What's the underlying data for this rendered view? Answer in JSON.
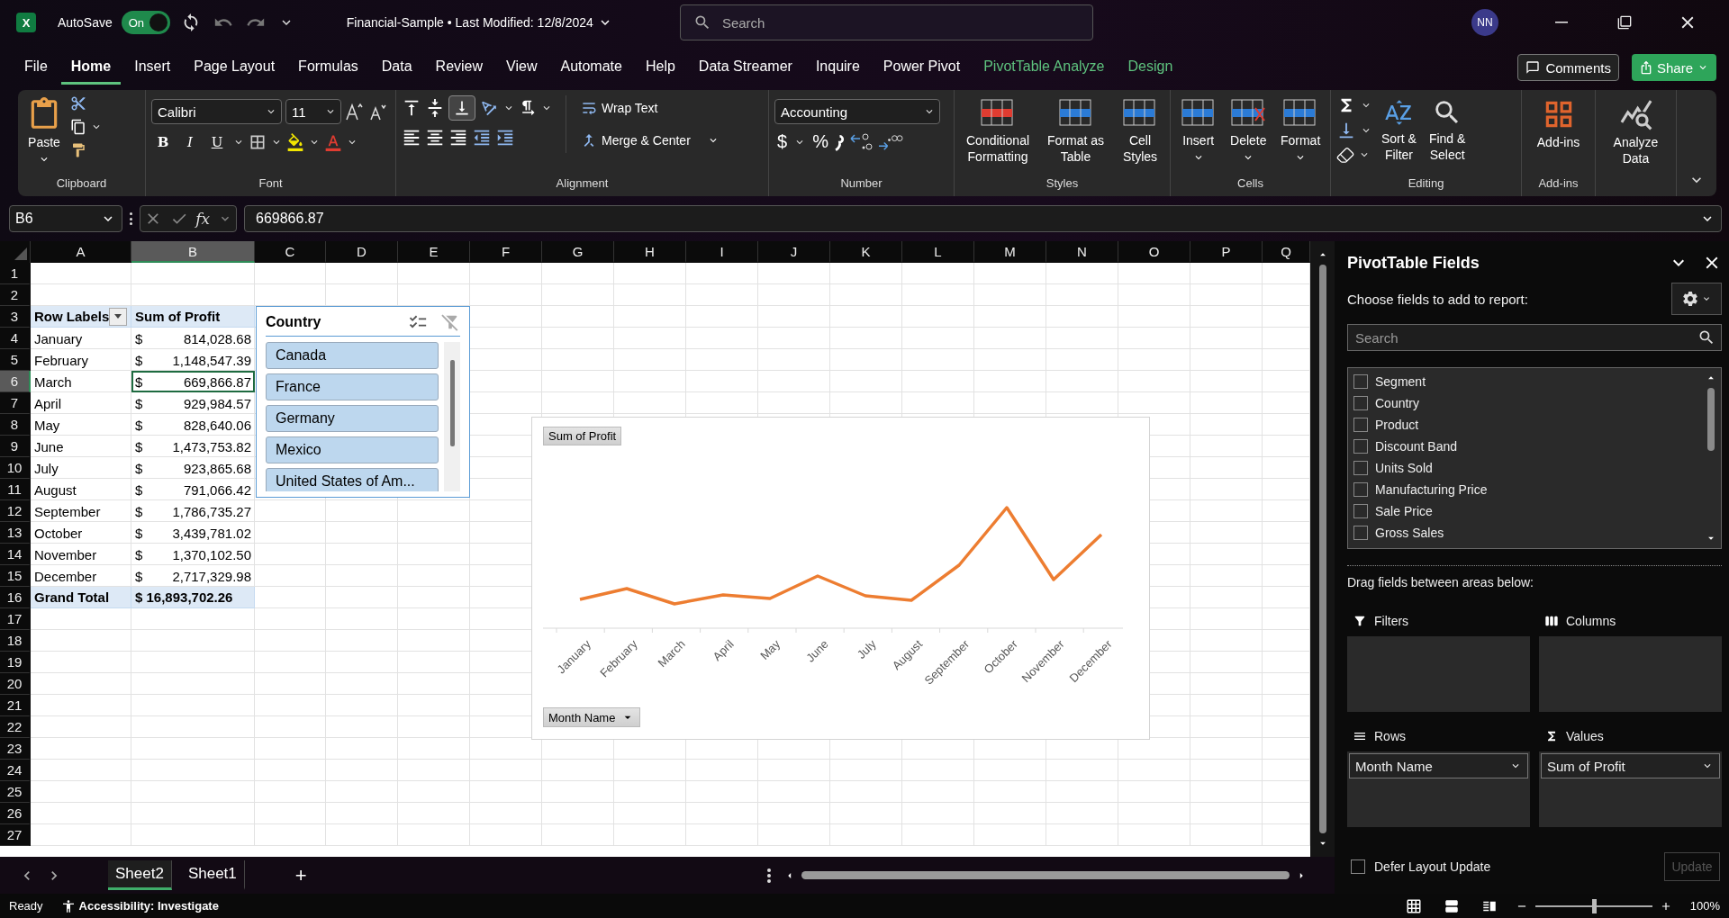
{
  "title_bar": {
    "logo_letter": "X",
    "autosave": {
      "label": "AutoSave",
      "on": true,
      "state": "On"
    },
    "document": "Financial-Sample • Last Modified: 12/8/2024",
    "search": {
      "placeholder": "Search"
    },
    "user_initials": "NN"
  },
  "menu_tabs": [
    {
      "label": "File",
      "selected": false,
      "kind": "normal"
    },
    {
      "label": "Home",
      "selected": true,
      "kind": "normal"
    },
    {
      "label": "Insert",
      "selected": false,
      "kind": "normal"
    },
    {
      "label": "Page Layout",
      "selected": false,
      "kind": "normal"
    },
    {
      "label": "Formulas",
      "selected": false,
      "kind": "normal"
    },
    {
      "label": "Data",
      "selected": false,
      "kind": "normal"
    },
    {
      "label": "Review",
      "selected": false,
      "kind": "normal"
    },
    {
      "label": "View",
      "selected": false,
      "kind": "normal"
    },
    {
      "label": "Automate",
      "selected": false,
      "kind": "normal"
    },
    {
      "label": "Help",
      "selected": false,
      "kind": "normal"
    },
    {
      "label": "Data Streamer",
      "selected": false,
      "kind": "normal"
    },
    {
      "label": "Inquire",
      "selected": false,
      "kind": "normal"
    },
    {
      "label": "Power Pivot",
      "selected": false,
      "kind": "normal"
    },
    {
      "label": "PivotTable Analyze",
      "selected": false,
      "kind": "contextual"
    },
    {
      "label": "Design",
      "selected": false,
      "kind": "contextual"
    }
  ],
  "comments_button": "Comments",
  "share_button": "Share",
  "ribbon": {
    "clipboard": {
      "label": "Clipboard",
      "paste": "Paste"
    },
    "font": {
      "label": "Font",
      "family": "Calibri",
      "size": "11",
      "bold": "B",
      "italic": "I",
      "underline": "U"
    },
    "alignment": {
      "label": "Alignment",
      "bottom_align_on": true,
      "wrap": "Wrap Text",
      "merge": "Merge & Center"
    },
    "number": {
      "label": "Number",
      "format": "Accounting",
      "currency": "$",
      "percent": "%"
    },
    "styles": {
      "label": "Styles",
      "buttons": [
        {
          "label": "Conditional\nFormatting",
          "kind": "conditional"
        },
        {
          "label": "Format as\nTable",
          "kind": "table"
        },
        {
          "label": "Cell\nStyles",
          "kind": "cell"
        }
      ]
    },
    "cells": {
      "label": "Cells",
      "buttons": [
        {
          "label": "Insert",
          "kind": "insert"
        },
        {
          "label": "Delete",
          "kind": "delete"
        },
        {
          "label": "Format",
          "kind": "format"
        }
      ]
    },
    "editing": {
      "label": "Editing",
      "buttons": [
        {
          "label": "Sort &\nFilter",
          "kind": "sort"
        },
        {
          "label": "Find &\nSelect",
          "kind": "find"
        }
      ]
    },
    "addins": {
      "label": "Add-ins",
      "button": "Add-ins"
    },
    "analyze": {
      "button": "Analyze\nData"
    }
  },
  "formula_bar": {
    "name_box": "B6",
    "fx": "fx",
    "value": "669866.87"
  },
  "sheet": {
    "columns": [
      {
        "label": "A",
        "selected": false
      },
      {
        "label": "B",
        "selected": true
      },
      {
        "label": "C",
        "selected": false
      },
      {
        "label": "D",
        "selected": false
      },
      {
        "label": "E",
        "selected": false
      },
      {
        "label": "F",
        "selected": false
      },
      {
        "label": "G",
        "selected": false
      },
      {
        "label": "H",
        "selected": false
      },
      {
        "label": "I",
        "selected": false
      },
      {
        "label": "J",
        "selected": false
      },
      {
        "label": "K",
        "selected": false
      },
      {
        "label": "L",
        "selected": false
      },
      {
        "label": "M",
        "selected": false
      },
      {
        "label": "N",
        "selected": false
      },
      {
        "label": "O",
        "selected": false
      },
      {
        "label": "P",
        "selected": false
      },
      {
        "label": "Q",
        "selected": false
      }
    ],
    "rows": [
      {
        "label": "1",
        "selected": false
      },
      {
        "label": "2",
        "selected": false
      },
      {
        "label": "3",
        "selected": false
      },
      {
        "label": "4",
        "selected": false
      },
      {
        "label": "5",
        "selected": false
      },
      {
        "label": "6",
        "selected": true
      },
      {
        "label": "7",
        "selected": false
      },
      {
        "label": "8",
        "selected": false
      },
      {
        "label": "9",
        "selected": false
      },
      {
        "label": "10",
        "selected": false
      },
      {
        "label": "11",
        "selected": false
      },
      {
        "label": "12",
        "selected": false
      },
      {
        "label": "13",
        "selected": false
      },
      {
        "label": "14",
        "selected": false
      },
      {
        "label": "15",
        "selected": false
      },
      {
        "label": "16",
        "selected": false
      },
      {
        "label": "17",
        "selected": false
      },
      {
        "label": "18",
        "selected": false
      },
      {
        "label": "19",
        "selected": false
      },
      {
        "label": "20",
        "selected": false
      },
      {
        "label": "21",
        "selected": false
      },
      {
        "label": "22",
        "selected": false
      },
      {
        "label": "23",
        "selected": false
      },
      {
        "label": "24",
        "selected": false
      },
      {
        "label": "25",
        "selected": false
      },
      {
        "label": "26",
        "selected": false
      },
      {
        "label": "27",
        "selected": false
      }
    ]
  },
  "pivot_table": {
    "headers": [
      "Row Labels",
      "Sum of Profit"
    ],
    "rows": [
      {
        "label": "January",
        "currency": "$",
        "value": "814,028.68",
        "selected": false
      },
      {
        "label": "February",
        "currency": "$",
        "value": "1,148,547.39",
        "selected": false
      },
      {
        "label": "March",
        "currency": "$",
        "value": "669,866.87",
        "selected": true
      },
      {
        "label": "April",
        "currency": "$",
        "value": "929,984.57",
        "selected": false
      },
      {
        "label": "May",
        "currency": "$",
        "value": "828,640.06",
        "selected": false
      },
      {
        "label": "June",
        "currency": "$",
        "value": "1,473,753.82",
        "selected": false
      },
      {
        "label": "July",
        "currency": "$",
        "value": "923,865.68",
        "selected": false
      },
      {
        "label": "August",
        "currency": "$",
        "value": "791,066.42",
        "selected": false
      },
      {
        "label": "September",
        "currency": "$",
        "value": "1,786,735.27",
        "selected": false
      },
      {
        "label": "October",
        "currency": "$",
        "value": "3,439,781.02",
        "selected": false
      },
      {
        "label": "November",
        "currency": "$",
        "value": "1,370,102.50",
        "selected": false
      },
      {
        "label": "December",
        "currency": "$",
        "value": "2,717,329.98",
        "selected": false
      }
    ],
    "total": {
      "label": "Grand Total",
      "value": "$ 16,893,702.26"
    }
  },
  "slicer": {
    "title": "Country",
    "items": [
      {
        "label": "Canada",
        "selected": true
      },
      {
        "label": "France",
        "selected": true
      },
      {
        "label": "Germany",
        "selected": true
      },
      {
        "label": "Mexico",
        "selected": true
      },
      {
        "label": "United States of Am...",
        "selected": true
      }
    ]
  },
  "chart": {
    "value_button": "Sum of Profit",
    "axis_button": "Month Name",
    "categories": [
      "January",
      "February",
      "March",
      "April",
      "May",
      "June",
      "July",
      "August",
      "September",
      "October",
      "November",
      "December"
    ]
  },
  "sheet_tabs": [
    {
      "label": "Sheet2",
      "selected": true
    },
    {
      "label": "Sheet1",
      "selected": false
    }
  ],
  "add_sheet": "+",
  "pivot_fields": {
    "title": "PivotTable Fields",
    "subtitle": "Choose fields to add to report:",
    "search": {
      "placeholder": "Search"
    },
    "fields": [
      {
        "label": "Segment",
        "checked": false
      },
      {
        "label": "Country",
        "checked": false
      },
      {
        "label": "Product",
        "checked": false
      },
      {
        "label": "Discount Band",
        "checked": false
      },
      {
        "label": "Units Sold",
        "checked": false
      },
      {
        "label": "Manufacturing Price",
        "checked": false
      },
      {
        "label": "Sale Price",
        "checked": false
      },
      {
        "label": "Gross Sales",
        "checked": false
      }
    ],
    "drag_hint": "Drag fields between areas below:",
    "areas": [
      {
        "title": "Filters",
        "kind": "filters"
      },
      {
        "title": "Columns",
        "kind": "columns"
      },
      {
        "title": "Rows",
        "kind": "rows",
        "items": [
          "Month Name"
        ]
      },
      {
        "title": "Values",
        "kind": "values",
        "items": [
          "Sum of Profit"
        ]
      }
    ],
    "defer": {
      "label": "Defer Layout Update",
      "checked": false
    },
    "update": {
      "label": "Update",
      "disabled": true
    }
  },
  "status_bar": {
    "ready": "Ready",
    "accessibility": "Accessibility: Investigate",
    "zoom": {
      "level": 0.5,
      "reading": "100%"
    }
  }
}
